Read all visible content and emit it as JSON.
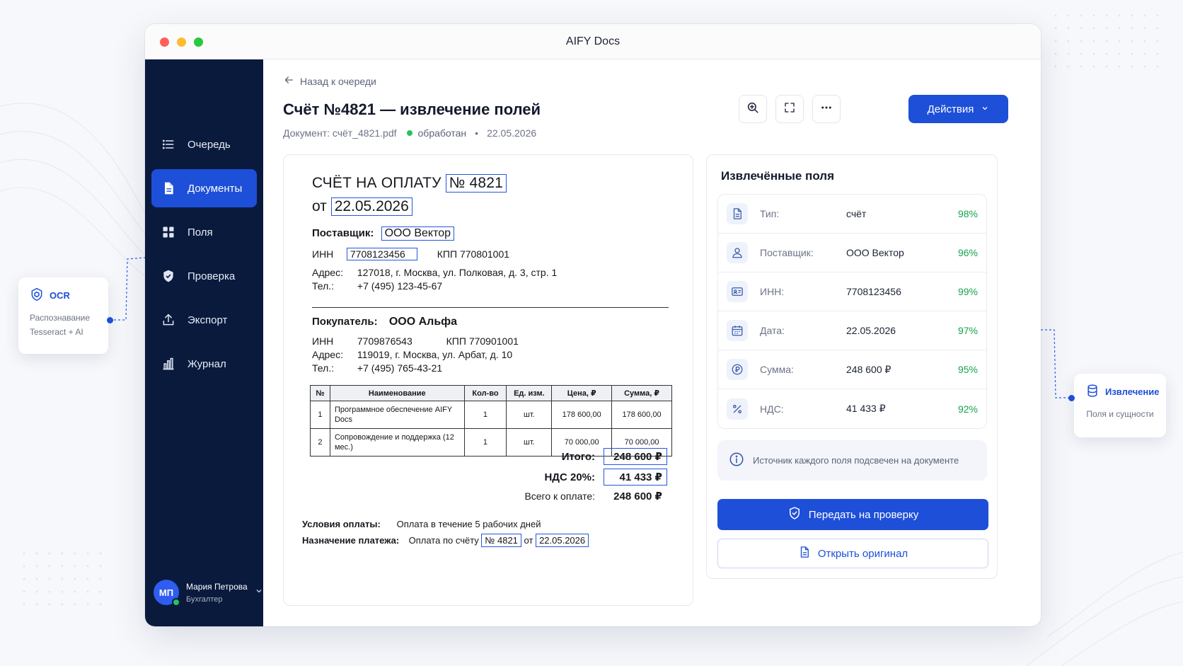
{
  "window": {
    "title": "AIFY Docs"
  },
  "sidebar": {
    "items": [
      {
        "label": "Очередь",
        "icon": "list-icon"
      },
      {
        "label": "Документы",
        "icon": "document-icon"
      },
      {
        "label": "Поля",
        "icon": "grid-icon"
      },
      {
        "label": "Проверка",
        "icon": "shield-check-icon"
      },
      {
        "label": "Экспорт",
        "icon": "upload-icon"
      },
      {
        "label": "Журнал",
        "icon": "bar-chart-icon"
      }
    ],
    "active_index": 1,
    "user": {
      "initials": "МП",
      "name": "Мария Петрова",
      "role": "Бухгалтер"
    }
  },
  "header": {
    "back_label": "Назад к очереди",
    "title": "Счёт №4821 — извлечение полей",
    "doc_label": "Документ: счёт_4821.pdf",
    "status": "обработан",
    "separator": "•",
    "date": "22.05.2026",
    "actions_label": "Действия"
  },
  "document": {
    "heading": "СЧЁТ НА ОПЛАТУ",
    "number": "№ 4821",
    "date_prefix": "от",
    "date": "22.05.2026",
    "supplier": {
      "label": "Поставщик:",
      "name": "ООО Вектор",
      "inn_label": "ИНН",
      "inn": "7708123456",
      "kpp": "КПП 770801001",
      "address_label": "Адрес:",
      "address": "127018, г. Москва, ул. Полковая, д. 3, стр. 1",
      "phone_label": "Тел.:",
      "phone": "+7 (495) 123-45-67"
    },
    "buyer": {
      "label": "Покупатель:",
      "name": "ООО Альфа",
      "inn_label": "ИНН",
      "inn": "7709876543",
      "kpp": "КПП 770901001",
      "address_label": "Адрес:",
      "address": "119019, г. Москва, ул. Арбат, д. 10",
      "phone_label": "Тел.:",
      "phone": "+7 (495) 765-43-21"
    },
    "table": {
      "headers": [
        "№",
        "Наименование",
        "Кол-во",
        "Ед. изм.",
        "Цена, ₽",
        "Сумма, ₽"
      ],
      "rows": [
        [
          "1",
          "Программное обеспечение AIFY Docs",
          "1",
          "шт.",
          "178 600,00",
          "178 600,00"
        ],
        [
          "2",
          "Сопровождение и поддержка (12 мес.)",
          "1",
          "шт.",
          "70 000,00",
          "70 000,00"
        ]
      ]
    },
    "totals": {
      "total_label": "Итого:",
      "total": "248 600 ₽",
      "vat_label": "НДС 20%:",
      "vat": "41 433 ₽",
      "due_label": "Всего к оплате:",
      "due": "248 600 ₽"
    },
    "terms": {
      "label": "Условия оплаты:",
      "value": "Оплата в течение 5 рабочих дней"
    },
    "purpose": {
      "label": "Назначение платежа:",
      "text": "Оплата по счёту",
      "number": "№ 4821",
      "from": "от",
      "date": "22.05.2026"
    }
  },
  "extracted": {
    "title": "Извлечённые поля",
    "fields": [
      {
        "icon": "file-icon",
        "label": "Тип:",
        "value": "счёт",
        "confidence": "98%"
      },
      {
        "icon": "user-icon",
        "label": "Поставщик:",
        "value": "ООО Вектор",
        "confidence": "96%"
      },
      {
        "icon": "id-card-icon",
        "label": "ИНН:",
        "value": "7708123456",
        "confidence": "99%"
      },
      {
        "icon": "calendar-icon",
        "label": "Дата:",
        "value": "22.05.2026",
        "confidence": "97%"
      },
      {
        "icon": "ruble-icon",
        "label": "Сумма:",
        "value": "248 600 ₽",
        "confidence": "95%"
      },
      {
        "icon": "percent-icon",
        "label": "НДС:",
        "value": "41 433 ₽",
        "confidence": "92%"
      }
    ],
    "note": "Источник каждого поля подсвечен на документе",
    "primary_button": "Передать на проверку",
    "secondary_button": "Открыть оригинал"
  },
  "badges": {
    "ocr": {
      "title": "OCR",
      "line1": "Распознавание",
      "line2": "Tesseract + AI"
    },
    "extraction": {
      "title": "Извлечение",
      "subtitle": "Поля и сущности"
    }
  },
  "colors": {
    "accent": "#1d4fd8",
    "sidebar_bg": "#0a1a3d",
    "success": "#16a34a",
    "highlight_border": "#2457e0"
  }
}
